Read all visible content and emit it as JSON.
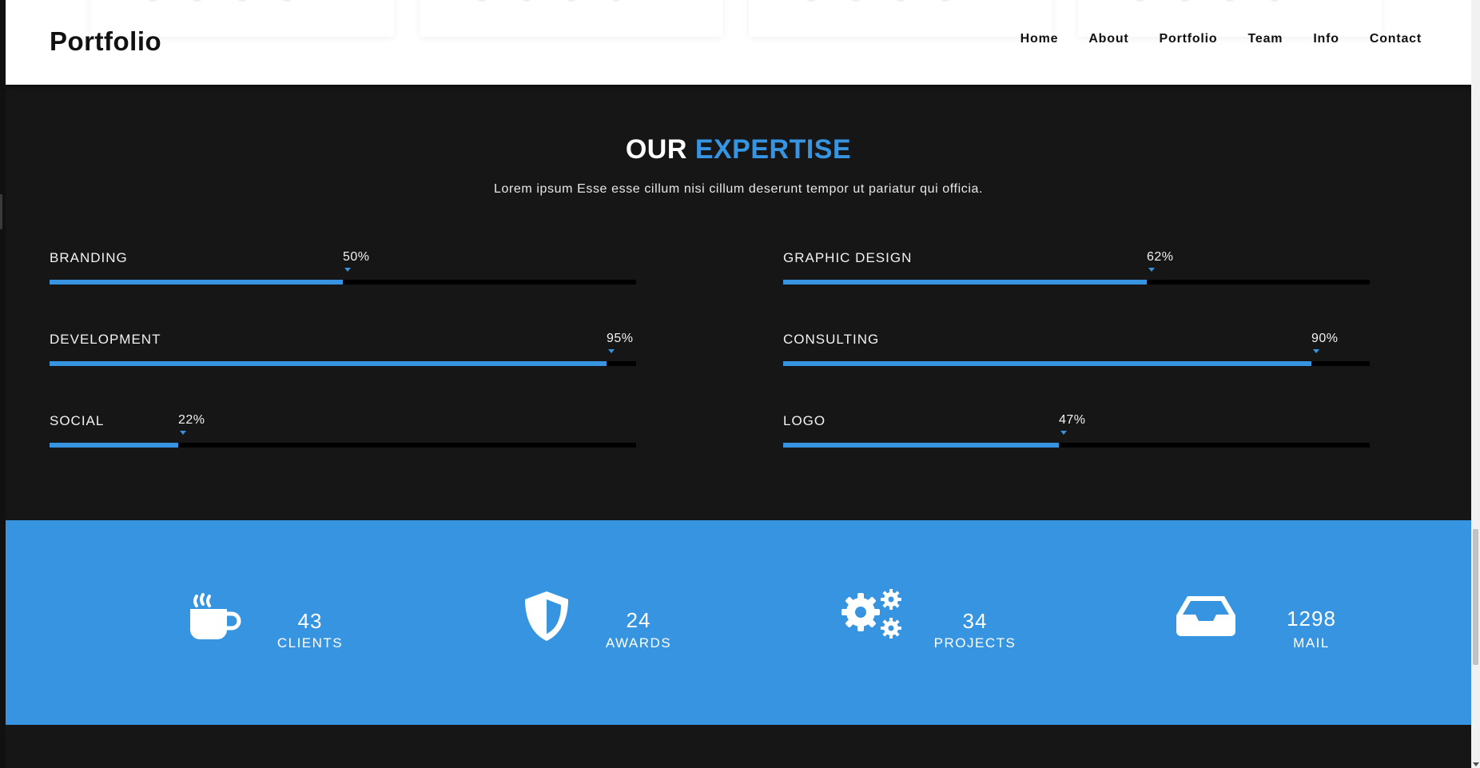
{
  "brand": "Portfolio",
  "nav": [
    "Home",
    "About",
    "Portfolio",
    "Team",
    "Info",
    "Contact"
  ],
  "expertise": {
    "title_white": "OUR",
    "title_blue": "EXPERTISE",
    "subtitle": "Lorem ipsum Esse esse cillum nisi cillum deserunt tempor ut pariatur qui officia.",
    "skills": [
      {
        "label": "BRANDING",
        "percent_text": "50%",
        "value": 50
      },
      {
        "label": "GRAPHIC DESIGN",
        "percent_text": "62%",
        "value": 62
      },
      {
        "label": "DEVELOPMENT",
        "percent_text": "95%",
        "value": 95
      },
      {
        "label": "CONSULTING",
        "percent_text": "90%",
        "value": 90
      },
      {
        "label": "SOCIAL",
        "percent_text": "22%",
        "value": 22
      },
      {
        "label": "LOGO",
        "percent_text": "47%",
        "value": 47
      }
    ]
  },
  "stats": [
    {
      "number": "43",
      "label": "CLIENTS",
      "icon": "coffee-cup-icon"
    },
    {
      "number": "24",
      "label": "AWARDS",
      "icon": "shield-icon"
    },
    {
      "number": "34",
      "label": "PROJECTS",
      "icon": "gears-icon"
    },
    {
      "number": "1298",
      "label": "MAIL",
      "icon": "inbox-icon"
    }
  ],
  "colors": {
    "accent": "#3794e0",
    "dark": "#161616",
    "header": "#ffffff"
  }
}
